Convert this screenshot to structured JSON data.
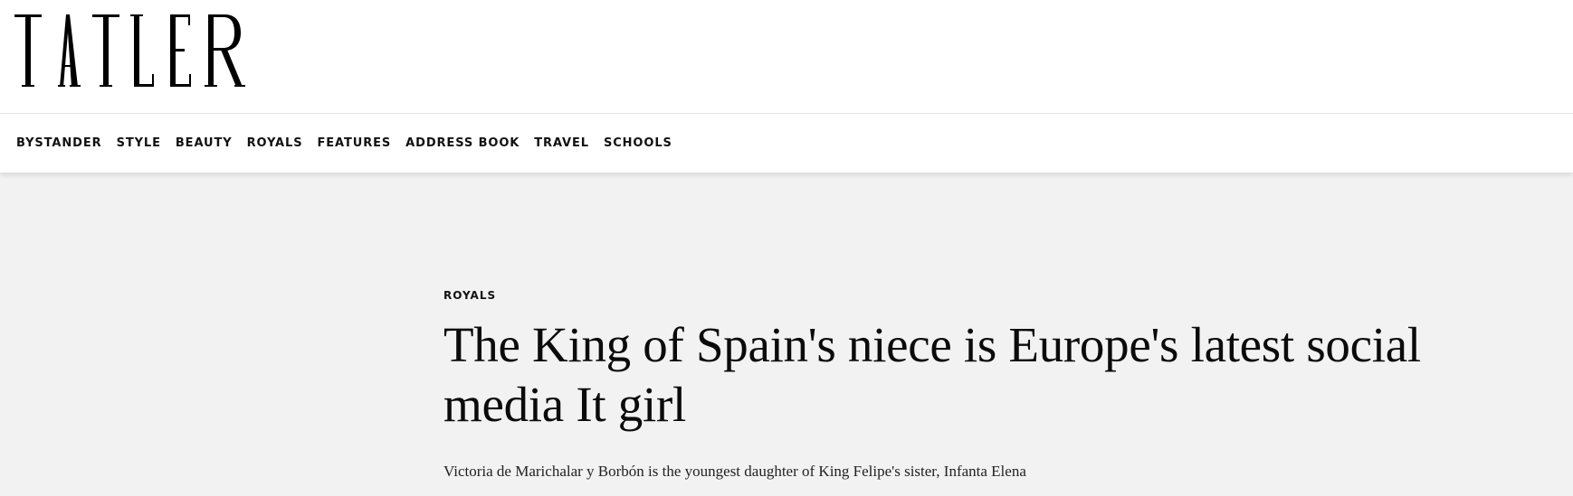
{
  "header": {
    "logo_text": "TATLER"
  },
  "nav": {
    "items": [
      {
        "label": "BYSTANDER"
      },
      {
        "label": "STYLE"
      },
      {
        "label": "BEAUTY"
      },
      {
        "label": "ROYALS"
      },
      {
        "label": "FEATURES"
      },
      {
        "label": "ADDRESS BOOK"
      },
      {
        "label": "TRAVEL"
      },
      {
        "label": "SCHOOLS"
      }
    ]
  },
  "article": {
    "category": "ROYALS",
    "headline": "The King of Spain's niece is Europe's latest social media It girl",
    "dek": "Victoria de Marichalar y Borbón is the youngest daughter of King Felipe's sister, Infanta Elena"
  },
  "colors": {
    "page_background": "#f2f2f2",
    "header_background": "#ffffff",
    "text": "#0b0b0b"
  }
}
